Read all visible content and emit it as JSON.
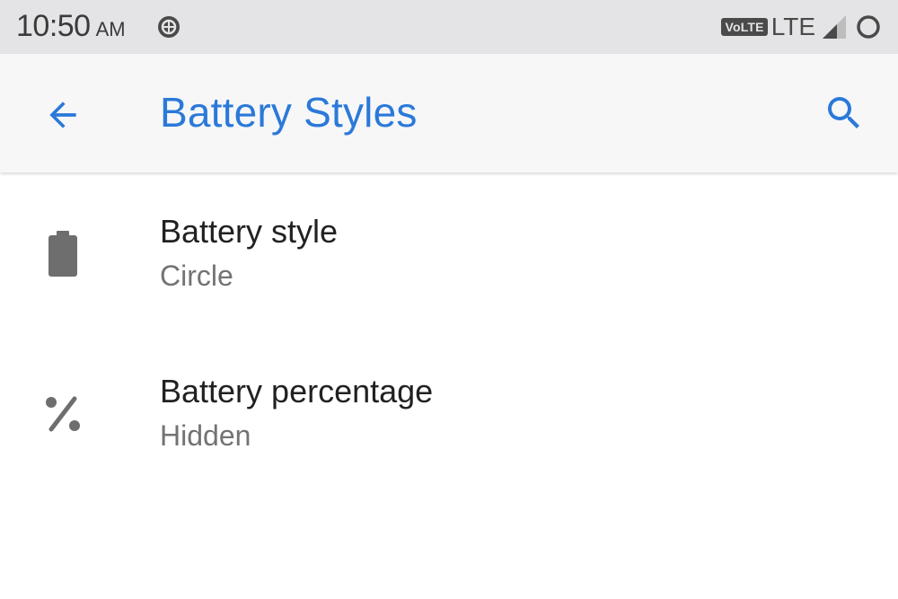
{
  "status_bar": {
    "time": "10:50",
    "ampm": "AM",
    "volte": "VoLTE",
    "network": "LTE"
  },
  "app_bar": {
    "title": "Battery Styles"
  },
  "settings": [
    {
      "title": "Battery style",
      "summary": "Circle"
    },
    {
      "title": "Battery percentage",
      "summary": "Hidden"
    }
  ],
  "colors": {
    "accent": "#2b79d9",
    "status_bar_bg": "#e4e4e6",
    "app_bar_bg": "#f7f7f8",
    "title_text": "#212121",
    "summary_text": "#737373",
    "icon_gray": "#6e6e6e"
  },
  "icons": {
    "back": "arrow-back-icon",
    "search": "search-icon",
    "battery_style": "battery-icon",
    "battery_percentage": "percent-icon"
  }
}
